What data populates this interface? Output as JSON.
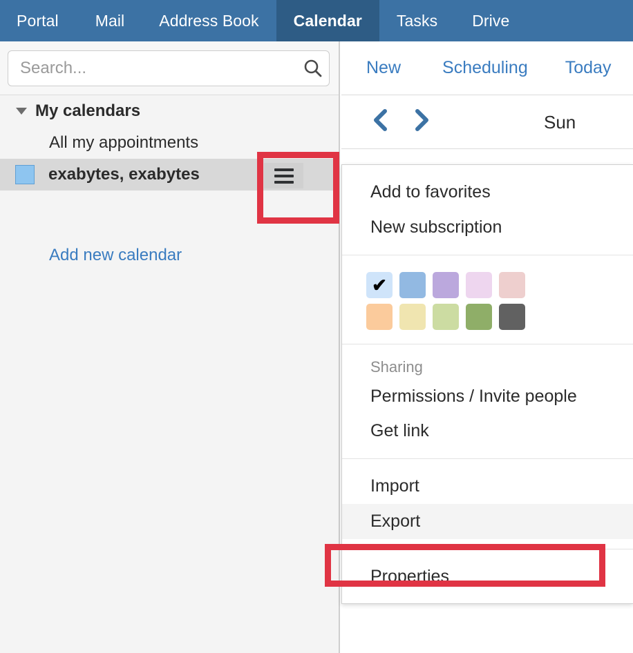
{
  "topnav": {
    "tabs": [
      {
        "label": "Portal",
        "active": false
      },
      {
        "label": "Mail",
        "active": false
      },
      {
        "label": "Address Book",
        "active": false
      },
      {
        "label": "Calendar",
        "active": true
      },
      {
        "label": "Tasks",
        "active": false
      },
      {
        "label": "Drive",
        "active": false
      }
    ],
    "active_tab": "Calendar",
    "background_color": "#3c72a4",
    "active_background_color": "#2e5c85"
  },
  "sidebar": {
    "search": {
      "placeholder": "Search...",
      "value": "",
      "icon": "search-icon"
    },
    "group": {
      "title": "My calendars",
      "expanded": true,
      "caret_icon": "caret-down-icon"
    },
    "items": [
      {
        "label": "All my appointments",
        "selected": false,
        "has_color_swatch": false
      },
      {
        "label": "exabytes, exabytes",
        "selected": true,
        "has_color_swatch": true,
        "swatch_color": "#8ec5f0",
        "menu_button_icon": "hamburger-icon"
      }
    ],
    "add_calendar_label": "Add new calendar",
    "add_calendar_color": "#3a7cc0"
  },
  "toolbar": {
    "buttons": [
      {
        "label": "New"
      },
      {
        "label": "Scheduling"
      },
      {
        "label": "Today"
      }
    ],
    "link_color": "#3a7cc0"
  },
  "daybar": {
    "prev_icon": "chevron-left-icon",
    "next_icon": "chevron-right-icon",
    "day_label": "Sun"
  },
  "context_menu": {
    "sections": [
      {
        "type": "items",
        "items": [
          {
            "label": "Add to favorites",
            "hovered": false
          },
          {
            "label": "New subscription",
            "hovered": false
          }
        ]
      },
      {
        "type": "colors",
        "rows": [
          [
            {
              "color": "#cfe4fa",
              "selected": true
            },
            {
              "color": "#92b9e2",
              "selected": false
            },
            {
              "color": "#bba8dd",
              "selected": false
            },
            {
              "color": "#eed6ef",
              "selected": false
            },
            {
              "color": "#eecfce",
              "selected": false
            }
          ],
          [
            {
              "color": "#fbcb9c",
              "selected": false
            },
            {
              "color": "#f0e5b0",
              "selected": false
            },
            {
              "color": "#ccdca2",
              "selected": false
            },
            {
              "color": "#8fae68",
              "selected": false
            },
            {
              "color": "#616161",
              "selected": false
            }
          ]
        ],
        "selected_check_glyph": "✔"
      },
      {
        "type": "items",
        "label": "Sharing",
        "items": [
          {
            "label": "Permissions / Invite people",
            "hovered": false
          },
          {
            "label": "Get link",
            "hovered": false
          }
        ]
      },
      {
        "type": "items",
        "items": [
          {
            "label": "Import",
            "hovered": false
          },
          {
            "label": "Export",
            "hovered": true
          }
        ]
      },
      {
        "type": "items",
        "items": [
          {
            "label": "Properties",
            "hovered": false
          }
        ]
      }
    ]
  },
  "annotations": {
    "color": "#e03444",
    "boxes": [
      {
        "target": "hamburger-menu-button"
      },
      {
        "target": "export-menu-item"
      }
    ]
  }
}
